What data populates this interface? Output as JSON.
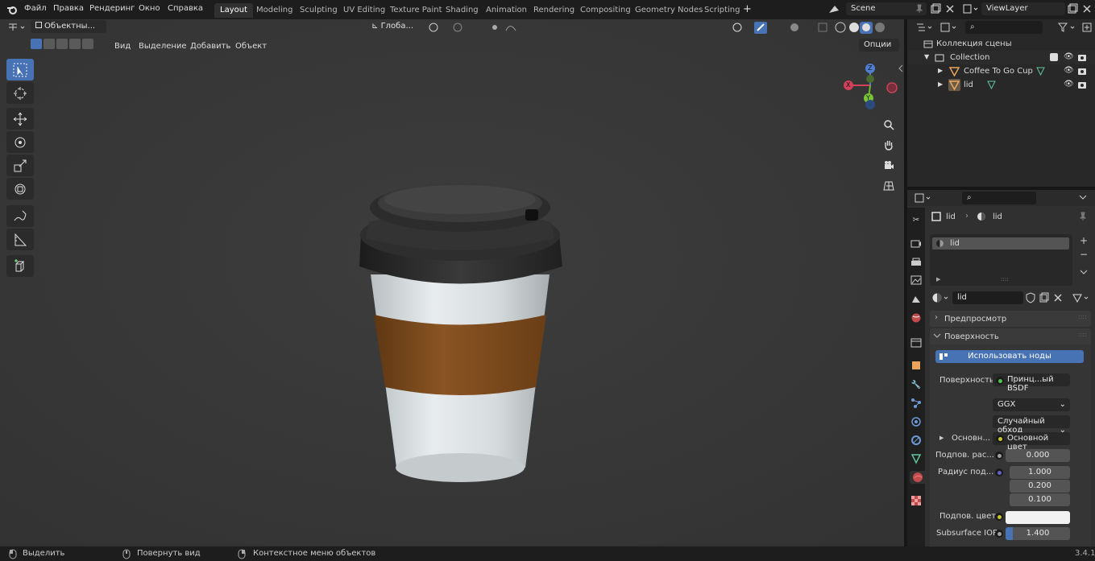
{
  "topbar": {
    "menus": [
      "Файл",
      "Правка",
      "Рендеринг",
      "Окно",
      "Справка"
    ],
    "workspaces": [
      "Layout",
      "Modeling",
      "Sculpting",
      "UV Editing",
      "Texture Paint",
      "Shading",
      "Animation",
      "Rendering",
      "Compositing",
      "Geometry Nodes",
      "Scripting"
    ],
    "active_workspace": "Layout",
    "add_tab": "+",
    "scene": "Scene",
    "view_layer": "ViewLayer"
  },
  "viewport_header": {
    "mode": "Объектны...",
    "menus": [
      "Вид",
      "Выделение",
      "Добавить",
      "Объект"
    ],
    "orientation": "Глоба...",
    "options": "Опции"
  },
  "gizmo": {
    "x": "X",
    "y": "Y",
    "z": "Z"
  },
  "outliner": {
    "scene_collection": "Коллекция сцены",
    "collection": "Collection",
    "items": [
      "Coffee To Go Cup",
      "lid"
    ]
  },
  "properties": {
    "breadcrumb_obj": "lid",
    "breadcrumb_mat": "lid",
    "slot": "lid",
    "material_name": "lid",
    "preview": "Предпросмотр",
    "surface_panel": "Поверхность",
    "use_nodes": "Использовать ноды",
    "surface_label": "Поверхность",
    "surface_value": "Принц...ый BSDF",
    "distribution": "GGX",
    "subsurface_method": "Случайный обход",
    "base_label": "Основн...",
    "base_value": "Основной цвет",
    "subsurface_label": "Подпов. рас...",
    "subsurface_value": "0.000",
    "radius_label": "Радиус под...",
    "radius": [
      "1.000",
      "0.200",
      "0.100"
    ],
    "sss_color_label": "Подпов. цвет",
    "ior_label": "Subsurface IOR",
    "ior_value": "1.400"
  },
  "statusbar": {
    "select": "Выделить",
    "rotate": "Повернуть вид",
    "context": "Контекстное меню объектов",
    "version": "3.4.1"
  },
  "colors": {
    "accent": "#4772b3",
    "cup_sleeve": "#7a4a1e",
    "lid": "#2a2a2a",
    "cup_body": "#d5dadc"
  }
}
